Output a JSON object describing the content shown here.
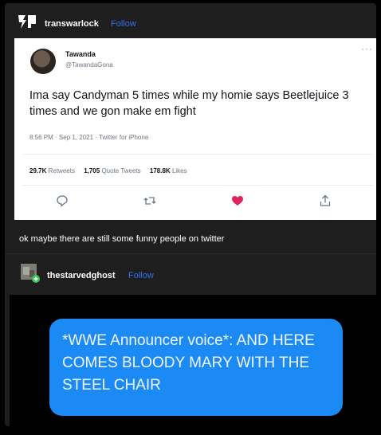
{
  "post": {
    "username": "transwarlock",
    "follow_label": "Follow"
  },
  "tweet": {
    "display_name": "Tawanda",
    "handle": "@TawandaGona",
    "more": "···",
    "text": "Ima say Candyman 5 times while my homie says Beetlejuice 3 times and we gon make em fight",
    "meta": "8:56 PM · Sep 1, 2021 · Twitter for iPhone",
    "retweets_count": "29.7K",
    "retweets_label": "Retweets",
    "quotes_count": "1,705",
    "quotes_label": "Quote Tweets",
    "likes_count": "178.8K",
    "likes_label": "Likes",
    "actions": [
      "reply-icon",
      "retweet-icon",
      "like-icon",
      "share-icon"
    ],
    "like_color": "#e0245e"
  },
  "caption": "ok maybe there are still some funny people on twitter",
  "reblog": {
    "username": "thestarvedghost",
    "follow_label": "Follow"
  },
  "message": {
    "text": "*WWE Announcer voice*: AND HERE COMES BLOODY MARY WITH THE STEEL CHAIR",
    "bubble_color": "#1b8af5"
  },
  "colors": {
    "background": "#1e1e1e",
    "accent_link": "#2f6fed"
  }
}
